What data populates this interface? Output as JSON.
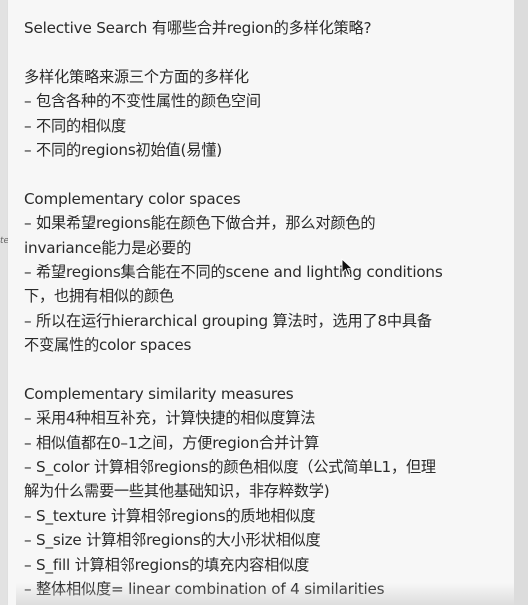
{
  "note": {
    "title": "Selective Search 有哪些合并region的多样化策略?",
    "section1": {
      "heading": "多样化策略来源三个方面的多样化",
      "items": [
        "– 包含各种的不变性属性的颜色空间",
        "– 不同的相似度",
        "– 不同的regions初始值(易懂)"
      ]
    },
    "section2": {
      "heading": "Complementary color spaces",
      "lines": [
        "– 如果希望regions能在颜色下做合并，那么对颜色的",
        "invariance能力是必要的",
        "– 希望regions集合能在不同的scene and lighting conditions",
        "下，也拥有相似的颜色",
        "– 所以在运行hierarchical grouping 算法时，选用了8中具备",
        "不变属性的color spaces"
      ]
    },
    "section3": {
      "heading": "Complementary similarity measures",
      "lines": [
        "– 采用4种相互补充，计算快捷的相似度算法",
        "– 相似值都在0–1之间，方便region合并计算",
        "– S_color 计算相邻regions的颜色相似度（公式简单L1，但理",
        "解为什么需要一些其他基础知识，非存粹数学)",
        "– S_texture 计算相邻regions的质地相似度",
        "– S_size 计算相邻regions的大小形状相似度",
        "– S_fill 计算相邻regions的填充内容相似度",
        "– 整体相似度= linear combination of 4 similarities"
      ]
    }
  },
  "gutter": {
    "glyph": "te"
  },
  "colors": {
    "panel_background": "#f7f7f7",
    "text": "#2a2a2a",
    "side_background": "#e2e2e2"
  },
  "icons": {
    "cursor": "mouse-pointer-icon"
  }
}
